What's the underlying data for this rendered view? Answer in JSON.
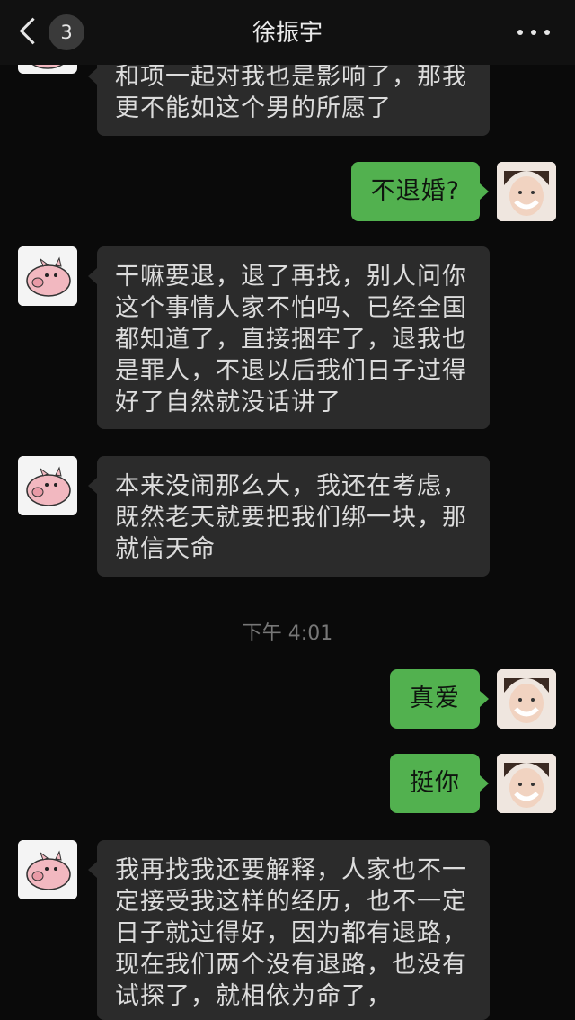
{
  "header": {
    "back_count": "3",
    "title": "徐振宇",
    "icons": [
      "chevron-left-icon",
      "more-dots-icon"
    ]
  },
  "messages": [
    {
      "side": "left",
      "text": "和项一起对我也是影响了，那我更不能如这个男的所愿了"
    },
    {
      "side": "right",
      "text": "不退婚?"
    },
    {
      "side": "left",
      "text": "干嘛要退，退了再找，别人问你这个事情人家不怕吗、已经全国都知道了，直接捆牢了，退我也是罪人，不退以后我们日子过得好了自然就没话讲了"
    },
    {
      "side": "left",
      "text": "本来没闹那么大，我还在考虑，既然老天就要把我们绑一块，那就信天命"
    },
    {
      "side": "right",
      "text": "真爱"
    },
    {
      "side": "right",
      "text": "挺你"
    },
    {
      "side": "left",
      "text": "我再找我还要解释，人家也不一定接受我这样的经历，也不一定日子就过得好，因为都有退路，现在我们两个没有退路，也没有试探了，就相依为命了，"
    }
  ],
  "timestamp": "下午 4:01",
  "colors": {
    "green_bubble": "#52b14f",
    "gray_bubble": "#2b2b2b",
    "background": "#0a0a0a"
  }
}
